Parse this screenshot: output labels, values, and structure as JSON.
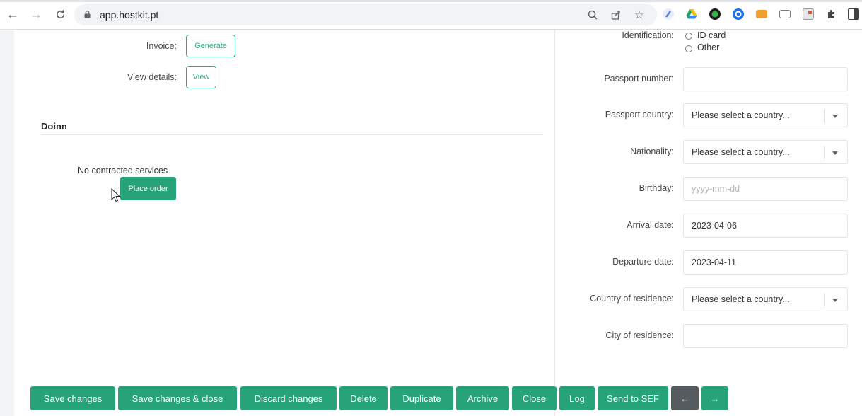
{
  "browser": {
    "url": "app.hostkit.pt"
  },
  "left": {
    "invoice_label": "Invoice:",
    "invoice_button": "Generate",
    "details_label": "View details:",
    "details_button": "View",
    "section_title": "Doinn",
    "no_services": "No contracted services",
    "place_order": "Place order"
  },
  "right": {
    "identification_label": "Identification:",
    "identification_options": [
      "ID card",
      "Other"
    ],
    "passport_number_label": "Passport number:",
    "passport_number_value": "",
    "passport_country_label": "Passport country:",
    "passport_country_value": "Please select a country...",
    "nationality_label": "Nationality:",
    "nationality_value": "Please select a country...",
    "birthday_label": "Birthday:",
    "birthday_placeholder": "yyyy-mm-dd",
    "arrival_label": "Arrival date:",
    "arrival_value": "2023-04-06",
    "departure_label": "Departure date:",
    "departure_value": "2023-04-11",
    "residence_country_label": "Country of residence:",
    "residence_country_value": "Please select a country...",
    "residence_city_label": "City of residence:",
    "residence_city_value": ""
  },
  "toolbar": {
    "save": "Save changes",
    "save_close": "Save changes & close",
    "discard": "Discard changes",
    "delete": "Delete",
    "duplicate": "Duplicate",
    "archive": "Archive",
    "close": "Close",
    "log": "Log",
    "send_sef": "Send to SEF",
    "prev": "←",
    "next": "→"
  },
  "colors": {
    "accent": "#27a37a",
    "dark_button": "#555b5e"
  }
}
